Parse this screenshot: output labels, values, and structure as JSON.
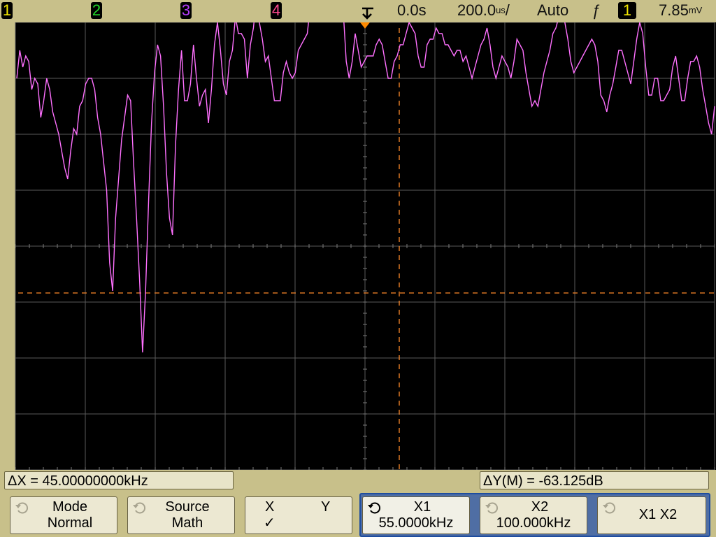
{
  "top_bar": {
    "channels": [
      {
        "label": "1",
        "color": "#f2e600"
      },
      {
        "label": "2",
        "color": "#22d82a"
      },
      {
        "label": "3",
        "color": "#b83dff"
      },
      {
        "label": "4",
        "color": "#ff4a90"
      }
    ],
    "time_offset": "0.0s",
    "time_per_div": "200.0",
    "time_per_div_unit": "us",
    "time_per_div_suffix": "/",
    "trigger_mode": "Auto",
    "trigger_slope_symbol": "ƒ",
    "trigger_source": "1",
    "trigger_level": "7.85",
    "trigger_level_unit": "mV"
  },
  "colors": {
    "trace": "#ff70ff",
    "cursor": "#ff8a2a",
    "grid": "#5a5a5a",
    "background": "#000000",
    "frame": "#c8c08a"
  },
  "waveform": {
    "trace": [
      7.0,
      7.5,
      7.2,
      7.4,
      7.3,
      6.8,
      7.0,
      6.9,
      6.3,
      6.6,
      7.0,
      6.8,
      6.4,
      6.2,
      6.0,
      5.7,
      5.4,
      5.2,
      5.7,
      6.1,
      6.0,
      6.5,
      6.6,
      6.9,
      7.0,
      7.0,
      6.8,
      6.3,
      6.0,
      5.5,
      5.0,
      3.7,
      3.2,
      4.5,
      5.2,
      5.9,
      6.3,
      6.7,
      6.6,
      5.5,
      4.5,
      3.4,
      2.1,
      3.2,
      4.8,
      6.2,
      7.1,
      7.6,
      7.4,
      6.5,
      5.3,
      4.5,
      4.2,
      5.8,
      6.8,
      7.5,
      6.6,
      6.6,
      6.9,
      7.6,
      7.0,
      6.5,
      6.7,
      6.8,
      6.2,
      6.8,
      7.6,
      8.0,
      7.5,
      6.9,
      6.7,
      7.3,
      7.5,
      8.1,
      7.8,
      7.8,
      7.7,
      7.0,
      7.6,
      7.9,
      8.4,
      8.0,
      7.7,
      7.3,
      7.4,
      7.0,
      6.6,
      6.6,
      6.6,
      7.1,
      7.3,
      7.1,
      7.0,
      7.1,
      7.5,
      7.6,
      7.7,
      7.8,
      8.3,
      8.5,
      8.3,
      8.8,
      9.5,
      10.3,
      11.3,
      12.0,
      11.5,
      10.4,
      9.2,
      8.2,
      7.3,
      7.0,
      7.3,
      7.8,
      7.5,
      7.2,
      7.3,
      7.4,
      7.4,
      7.4,
      7.6,
      7.7,
      7.6,
      7.3,
      7.0,
      7.0,
      7.3,
      7.4,
      7.6,
      7.6,
      7.8,
      8.0,
      7.9,
      7.8,
      7.4,
      7.2,
      7.2,
      7.6,
      7.7,
      7.7,
      7.9,
      7.8,
      7.8,
      7.6,
      7.6,
      7.5,
      7.4,
      7.5,
      7.5,
      7.3,
      7.4,
      7.2,
      7.0,
      7.2,
      7.4,
      7.6,
      7.7,
      7.9,
      7.6,
      7.2,
      7.0,
      7.2,
      7.4,
      7.3,
      7.2,
      7.0,
      7.3,
      7.7,
      7.6,
      7.5,
      7.1,
      6.8,
      6.5,
      6.6,
      6.5,
      6.8,
      7.1,
      7.3,
      7.5,
      7.8,
      7.9,
      8.1,
      8.2,
      8.0,
      7.7,
      7.3,
      7.1,
      7.2,
      7.3,
      7.4,
      7.5,
      7.6,
      7.7,
      7.6,
      7.3,
      6.7,
      6.6,
      6.4,
      6.7,
      6.9,
      7.2,
      7.5,
      7.5,
      7.3,
      7.1,
      6.9,
      7.3,
      7.7,
      8.0,
      7.8,
      7.2,
      6.7,
      6.7,
      7.0,
      7.0,
      6.6,
      6.6,
      6.7,
      6.8,
      7.2,
      7.4,
      7.0,
      6.6,
      6.6,
      7.0,
      7.3,
      7.3,
      7.4,
      7.2,
      6.8,
      6.5,
      6.2,
      6.0,
      6.5
    ]
  },
  "bottom_bar": {
    "delta_x_symbol": "Δ",
    "delta_x_text": "X = 45.00000000kHz",
    "delta_y_symbol": "Δ",
    "delta_y_text": "Y(M) = -63.125dB",
    "softkeys": {
      "mode": {
        "title": "Mode",
        "value": "Normal"
      },
      "source": {
        "title": "Source",
        "value": "Math"
      },
      "xy": {
        "x": "X",
        "y": "Y",
        "check": "✓"
      },
      "x1": {
        "title": "X1",
        "value": "55.0000kHz"
      },
      "x2": {
        "title": "X2",
        "value": "100.000kHz"
      },
      "x1x2": {
        "title": "X1 X2"
      }
    }
  }
}
